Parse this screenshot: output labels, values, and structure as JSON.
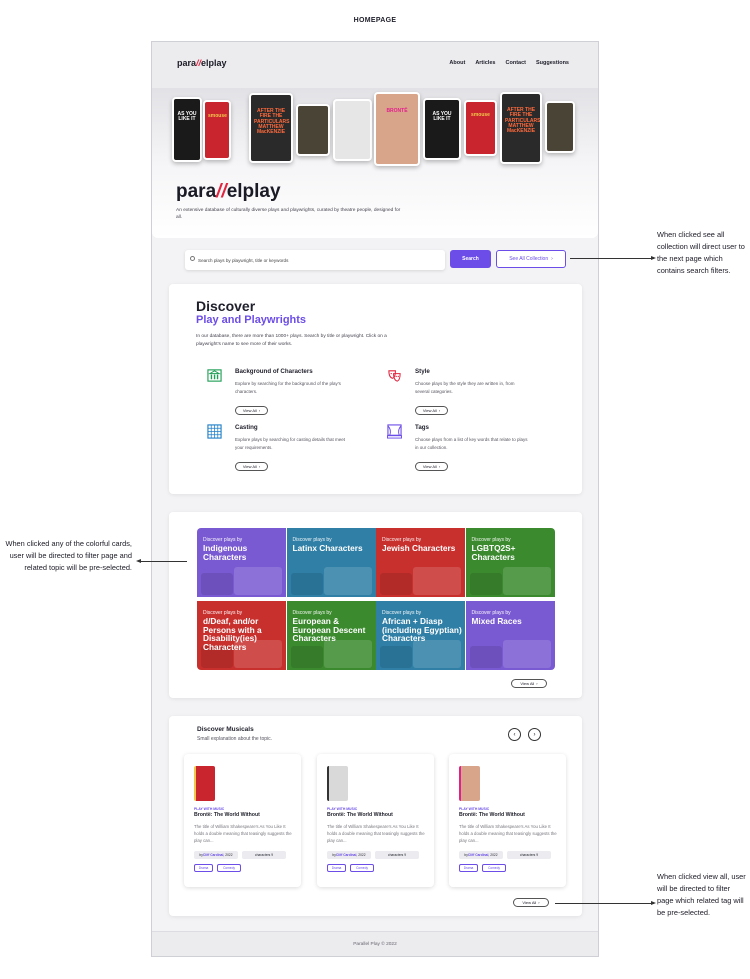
{
  "page_heading": "HOMEPAGE",
  "header": {
    "logo_pre": "para",
    "logo_slash": "//",
    "logo_post": "elplay",
    "nav": [
      "About",
      "Articles",
      "Contact",
      "Suggestions"
    ]
  },
  "hero": {
    "logo_pre": "para",
    "logo_slash": "//",
    "logo_post": "elplay",
    "tagline": "An extensive database of culturally diverse plays and playwrights, curated by theatre people, designed for all.",
    "covers": [
      {
        "text": "AS YOU LIKE IT",
        "bg": "#1a1a1a",
        "fg": "#ffffff"
      },
      {
        "text": "smouse",
        "bg": "#c8252e",
        "fg": "#f3c94c"
      },
      {
        "text": "AFTER THE FIRE THE PARTICULARS MATTHEW MacKENZIE",
        "bg": "#2a2a2a",
        "fg": "#ff6a3d"
      },
      {
        "text": "",
        "bg": "#4a4437",
        "fg": "#c9b98a"
      },
      {
        "text": "",
        "bg": "#e6e6e6",
        "fg": "#333333"
      },
      {
        "text": "BRONTË",
        "bg": "#d9a58a",
        "fg": "#e0208c"
      },
      {
        "text": "AS YOU LIKE IT",
        "bg": "#1a1a1a",
        "fg": "#ffffff"
      },
      {
        "text": "smouse",
        "bg": "#c8252e",
        "fg": "#f3c94c"
      },
      {
        "text": "AFTER THE FIRE THE PARTICULARS MATTHEW MacKENZIE",
        "bg": "#2a2a2a",
        "fg": "#ff6a3d"
      },
      {
        "text": "",
        "bg": "#4a4437",
        "fg": "#c9b98a"
      }
    ]
  },
  "search": {
    "placeholder": "Search plays by playwright, title or keywords",
    "button_label": "Search",
    "see_all_label": "See All Collection",
    "see_all_chevron": "›"
  },
  "discover": {
    "title": "Discover",
    "subtitle": "Play and Playwrights",
    "description": "In our database, there are more than 1000+ plays. Search by title or playwright. Click on a playwright's name to see more of their works.",
    "features": [
      {
        "title": "Background of Characters",
        "description": "Explore by searching for the background of the play's characters.",
        "button": "View All",
        "icon": "museum-icon",
        "color": "#1e9e55"
      },
      {
        "title": "Style",
        "description": "Choose plays by the style they are written in, from several categories.",
        "button": "View All",
        "icon": "theatre-masks-icon",
        "color": "#e2253f"
      },
      {
        "title": "Casting",
        "description": "Explore plays by searching for casting details that meet your requirements.",
        "button": "View All",
        "icon": "grid-icon",
        "color": "#1f7fc8"
      },
      {
        "title": "Tags",
        "description": "Choose plays from a list of key words that relate to plays in our collection.",
        "button": "View All",
        "icon": "stage-icon",
        "color": "#6c4de8"
      }
    ]
  },
  "categories": {
    "view_all": "View All",
    "items": [
      {
        "pre": "Discover plays by",
        "title": "Indigenous Characters",
        "color": "#7a5ad2"
      },
      {
        "pre": "Discover plays by",
        "title": "Latinx Characters",
        "color": "#2f7fa6"
      },
      {
        "pre": "Discover plays by",
        "title": "Jewish Characters",
        "color": "#c8302e"
      },
      {
        "pre": "Discover plays by",
        "title": "LGBTQ2S+ Characters",
        "color": "#3b8a2e"
      },
      {
        "pre": "Discover plays by",
        "title": "d/Deaf, and/or Persons with a Disability(ies) Characters",
        "color": "#c8302e"
      },
      {
        "pre": "Discover plays by",
        "title": "European & European Descent Characters",
        "color": "#3b8a2e"
      },
      {
        "pre": "Discover plays by",
        "title": "African + Diasp (including Egyptian) Characters",
        "color": "#2f7fa6"
      },
      {
        "pre": "Discover plays by",
        "title": "Mixed Races",
        "color": "#7a5ad2"
      }
    ]
  },
  "musicals": {
    "title": "Discover Musicals",
    "subtitle": "Small explanation about the topic.",
    "prev_arrow": "‹",
    "next_arrow": "›",
    "view_all": "View All",
    "cards": [
      {
        "tag": "PLAY WITH MUSIC",
        "title": "Brontë: The World Without",
        "description": "The title of William Shakespeare's As You Like It holds a double meaning that teasingly suggests the play can...",
        "by_prefix": "by",
        "author": "Cliff Cardinal",
        "year": ", 2022",
        "characters": "characters 9",
        "chips": [
          "Drama",
          "Comedy"
        ],
        "thumb_bg": "#c8252e",
        "thumb_fg": "#f3c94c"
      },
      {
        "tag": "PLAY WITH MUSIC",
        "title": "Brontë: The World Without",
        "description": "The title of William Shakespeare's As You Like It holds a double meaning that teasingly suggests the play can...",
        "by_prefix": "by",
        "author": "Cliff Cardinal",
        "year": ", 2022",
        "characters": "characters 9",
        "chips": [
          "Drama",
          "Comedy"
        ],
        "thumb_bg": "#d9d9d9",
        "thumb_fg": "#333333"
      },
      {
        "tag": "PLAY WITH MUSIC",
        "title": "Brontë: The World Without",
        "description": "The title of William Shakespeare's As You Like It holds a double meaning that teasingly suggests the play can...",
        "by_prefix": "by",
        "author": "Cliff Cardinal",
        "year": ", 2022",
        "characters": "characters 9",
        "chips": [
          "Drama",
          "Comedy"
        ],
        "thumb_bg": "#d9a58a",
        "thumb_fg": "#e0208c"
      }
    ]
  },
  "footer": {
    "text": "Parallel Play © 2022"
  },
  "annotations": {
    "see_all": "When clicked see all collection will direct user to the next page which contains search filters.",
    "cards": "When clicked any of the colorful cards, user will be directed to filter page and related topic will be pre-selected.",
    "view_all": "When clicked view all, user will be directed to filter page which related tag will be pre-selected."
  }
}
